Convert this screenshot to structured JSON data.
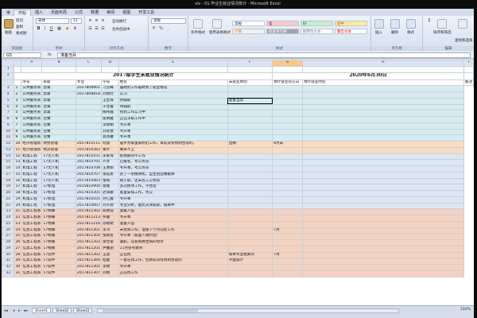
{
  "window": {
    "title": "xls - 01.毕业生就业情况统计 - Microsoft Excel"
  },
  "ribbon": {
    "tabs": [
      "开始",
      "插入",
      "页面布局",
      "公式",
      "数据",
      "审阅",
      "视图",
      "开发工具"
    ],
    "active_tab": 0,
    "clipboard": {
      "label": "剪贴板",
      "paste": "粘贴",
      "cut": "剪切",
      "copy": "复制",
      "painter": "格式刷"
    },
    "font": {
      "label": "字体",
      "name": "宋体",
      "size": "11"
    },
    "alignment": {
      "label": "对齐方式",
      "wrap": "自动换行",
      "merge": "合并后居中"
    },
    "number": {
      "label": "数字",
      "format": "常规"
    },
    "styles": {
      "label": "样式",
      "cond_format": "条件格式",
      "table_format": "套用表格格式",
      "cells": [
        {
          "text": "常规",
          "bg": "#ffffff",
          "fg": "#222222"
        },
        {
          "text": "差",
          "bg": "#ffc7ce",
          "fg": "#9c0006"
        },
        {
          "text": "好",
          "bg": "#c6efce",
          "fg": "#006100"
        },
        {
          "text": "适中",
          "bg": "#ffeb9c",
          "fg": "#9c6500"
        },
        {
          "text": "计算",
          "bg": "#f2f2f2",
          "fg": "#fa7d00"
        },
        {
          "text": "检查单元格",
          "bg": "#a5a5a5",
          "fg": "#ffffff"
        },
        {
          "text": "解释性文本",
          "bg": "#ffffff",
          "fg": "#7f7f7f"
        },
        {
          "text": "警告文本",
          "bg": "#ffffff",
          "fg": "#ff0000"
        }
      ]
    },
    "cells_group": {
      "label": "单元格",
      "insert": "插入",
      "delete": "删除",
      "format": "格式"
    },
    "editing": {
      "label": "编辑",
      "sort": "排序和筛选",
      "find": "查找和选择"
    }
  },
  "formula_bar": {
    "name_box": "G5",
    "fx": "fx",
    "content": "准备当兵"
  },
  "sheet": {
    "columns": [
      "A",
      "B",
      "C",
      "D",
      "E",
      "F",
      "G",
      "H",
      "I"
    ],
    "selected_column": "G",
    "title_row": {
      "left": "2017级学生未就业情况统计",
      "right": "2020年6月30日"
    },
    "headers": [
      "序号",
      "系部",
      "专业",
      "学号",
      "姓名",
      "未就业原因",
      "预计就业的方向",
      "预计就业时间",
      "备注"
    ],
    "rows": [
      {
        "n": "3",
        "g": "a",
        "c": [
          "1",
          "公共服务系",
          "禁毒",
          "2017808901",
          "刁云峰",
          "居政府工作临聘到了就业协议",
          "",
          "",
          ""
        ]
      },
      {
        "n": "4",
        "g": "a",
        "c": [
          "2",
          "公共服务系",
          "禁毒",
          "2017808818",
          "刘炳然",
          "实习",
          "",
          "",
          ""
        ]
      },
      {
        "n": "5",
        "g": "a",
        "c": [
          "3",
          "公共服务系",
          "禁毒",
          "",
          "王宏琛",
          "待辅职",
          "准备当兵",
          "",
          ""
        ]
      },
      {
        "n": "6",
        "g": "a",
        "c": [
          "4",
          "公共服务系",
          "禁毒",
          "",
          "于佳蔓",
          "待辅职",
          "",
          "",
          ""
        ]
      },
      {
        "n": "7",
        "g": "a",
        "c": [
          "5",
          "公共服务系",
          "禁毒",
          "",
          "梅伟鑫",
          "找到工作实习中",
          "",
          "",
          ""
        ]
      },
      {
        "n": "8",
        "g": "a",
        "c": [
          "6",
          "公共服务系",
          "空乘",
          "",
          "侯明雅",
          "正在求职工作中",
          "",
          "",
          ""
        ]
      },
      {
        "n": "9",
        "g": "a",
        "c": [
          "7",
          "公共服务系",
          "空乘",
          "",
          "李雨桐",
          "专升本",
          "",
          "",
          ""
        ]
      },
      {
        "n": "10",
        "g": "a",
        "c": [
          "8",
          "公共服务系",
          "空乘",
          "",
          "刘欣悦",
          "专升本",
          "",
          "",
          ""
        ]
      },
      {
        "n": "11",
        "g": "a",
        "c": [
          "9",
          "公共服务系",
          "空乘",
          "",
          "袁杏馨",
          "专升本",
          "",
          "",
          ""
        ]
      },
      {
        "n": "12",
        "g": "b",
        "c": [
          "10",
          "经济管理系",
          "财会管理",
          "2017810111",
          "何慧",
          "居乡务家里家附近工作，目前没有找到合适的。",
          "出纳",
          "8月末",
          ""
        ]
      },
      {
        "n": "13",
        "g": "b",
        "c": [
          "11",
          "经济管理系",
          "物流管理",
          "2017810382",
          "秦宇",
          "联系不上",
          "",
          "",
          ""
        ]
      },
      {
        "n": "14",
        "g": "c",
        "c": [
          "12",
          "机电工程",
          "17无人机",
          "2017810101",
          "李家琛",
          "疫情期间不工作",
          "",
          "",
          ""
        ]
      },
      {
        "n": "15",
        "g": "c",
        "c": [
          "13",
          "机电工程",
          "17无人机",
          "2017810701",
          "齐文",
          "已报名，考公务员",
          "",
          "",
          ""
        ]
      },
      {
        "n": "16",
        "g": "c",
        "c": [
          "14",
          "机电工程",
          "17无人机",
          "2017810708",
          "王季刚",
          "专升本，考公务员",
          "",
          "",
          ""
        ]
      },
      {
        "n": "17",
        "g": "c",
        "c": [
          "15",
          "机电工程",
          "17无人机",
          "2017810707",
          "张成莱",
          "买了一架植保机，自主创业做植保",
          "",
          "",
          ""
        ]
      },
      {
        "n": "18",
        "g": "c",
        "c": [
          "16",
          "机电工程",
          "17无人机",
          "2017810403",
          "邹铭",
          "刚入职，还未签三方协议",
          "",
          "",
          ""
        ]
      },
      {
        "n": "19",
        "g": "c",
        "c": [
          "17",
          "机电工程",
          "17机电",
          "2015810900",
          "蒋璧",
          "多次搜寻工作，不合适",
          "",
          "",
          ""
        ]
      },
      {
        "n": "20",
        "g": "c",
        "c": [
          "18",
          "机电工程",
          "17机电",
          "2017810301",
          "迟泽康",
          "家里安排工作，考公",
          "",
          "",
          ""
        ]
      },
      {
        "n": "21",
        "g": "c",
        "c": [
          "19",
          "机电工程",
          "17机电",
          "2017810101",
          "孙亿鑫",
          "专升本",
          "",
          "",
          ""
        ]
      },
      {
        "n": "22",
        "g": "c",
        "c": [
          "20",
          "机电工程",
          "17机电",
          "2017810607",
          "刘子源",
          "专业分析，能比天津就职，隔离中",
          "",
          "",
          ""
        ]
      },
      {
        "n": "23",
        "g": "d",
        "c": [
          "21",
          "信息工程系",
          "17物联",
          "2017811302",
          "陈明浩",
          "准备入伍",
          "",
          "",
          ""
        ]
      },
      {
        "n": "24",
        "g": "d",
        "c": [
          "22",
          "信息工程系",
          "17物联",
          "2017811213",
          "罗磊",
          "专升本",
          "",
          "",
          ""
        ]
      },
      {
        "n": "25",
        "g": "d",
        "c": [
          "23",
          "信息工程系",
          "17物联",
          "2017811216",
          "孙艳艳",
          "准备入伍",
          "",
          "",
          ""
        ]
      },
      {
        "n": "26",
        "g": "d",
        "c": [
          "24",
          "信息工程系",
          "17物联",
          "2017811301",
          "李鸿",
          "未找到工作，准备下个月前赴工作",
          "",
          "7月",
          ""
        ]
      },
      {
        "n": "27",
        "g": "d",
        "c": [
          "25",
          "信息工程系",
          "17物联",
          "2017811304",
          "邹雨皆",
          "专升本（家里人相约合）",
          "",
          "",
          ""
        ]
      },
      {
        "n": "28",
        "g": "d",
        "c": [
          "26",
          "信息工程系",
          "17物联",
          "2017811203",
          "张佳雷",
          "兼职，在家照顾生病的母亲",
          "",
          "",
          ""
        ]
      },
      {
        "n": "29",
        "g": "d",
        "c": [
          "27",
          "信息工程系",
          "17物联",
          "2017811201",
          "尹馨丽",
          "11月份考教师",
          "",
          "",
          ""
        ]
      },
      {
        "n": "30",
        "g": "d",
        "c": [
          "28",
          "信息工程系",
          "17软件",
          "2017811302",
          "王迪",
          "正在找",
          "和本专业相关的",
          "7月",
          ""
        ]
      },
      {
        "n": "31",
        "g": "d",
        "c": [
          "29",
          "信息工程系",
          "17软件",
          "2017811360",
          "程童",
          "一直在找工作，但目前没有找到合适的",
          "平面设计",
          "",
          ""
        ]
      },
      {
        "n": "32",
        "g": "d",
        "c": [
          "30",
          "信息工程系",
          "17软件",
          "2017811301",
          "李明",
          "专升本",
          "",
          "",
          ""
        ]
      },
      {
        "n": "33",
        "g": "d",
        "c": [
          "31",
          "信息工程系",
          "17软件",
          "2017811307",
          "刘畅",
          "正在找工作",
          "",
          "",
          ""
        ]
      }
    ]
  },
  "sheet_tabs": [
    "Sheet1",
    "Sheet2",
    "Sheet3"
  ],
  "active_sheet": 0,
  "status": {
    "zoom": "100%"
  }
}
